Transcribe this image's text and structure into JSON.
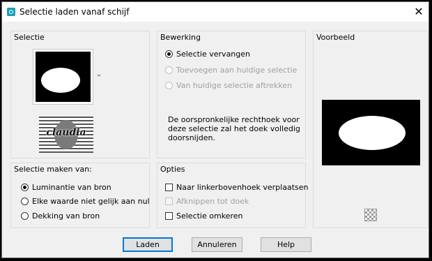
{
  "window": {
    "title": "Selectie laden vanaf schijf",
    "close_glyph": "✕"
  },
  "selectie": {
    "label": "Selectie",
    "logo_text": "claudia"
  },
  "bewerking": {
    "label": "Bewerking",
    "options": [
      {
        "label": "Selectie vervangen",
        "checked": true,
        "disabled": false
      },
      {
        "label": "Toevoegen aan huidige selectie",
        "checked": false,
        "disabled": true
      },
      {
        "label": "Van huidige selectie aftrekken",
        "checked": false,
        "disabled": true
      }
    ],
    "note": "De oorspronkelijke rechthoek voor deze selectie zal het doek volledig doorsnijden."
  },
  "voorbeeld": {
    "label": "Voorbeeld"
  },
  "maken": {
    "label": "Selectie maken van:",
    "options": [
      {
        "label": "Luminantie van bron",
        "checked": true
      },
      {
        "label": "Elke waarde niet gelijk aan nul",
        "checked": false
      },
      {
        "label": "Dekking van bron",
        "checked": false
      }
    ]
  },
  "opties": {
    "label": "Opties",
    "items": [
      {
        "label": "Naar linkerbovenhoek verplaatsen",
        "checked": false,
        "disabled": false
      },
      {
        "label": "Afknippen tot doek",
        "checked": false,
        "disabled": true
      },
      {
        "label": "Selectie omkeren",
        "checked": false,
        "disabled": false
      }
    ]
  },
  "buttons": {
    "load": "Laden",
    "cancel": "Annuleren",
    "help": "Help"
  }
}
